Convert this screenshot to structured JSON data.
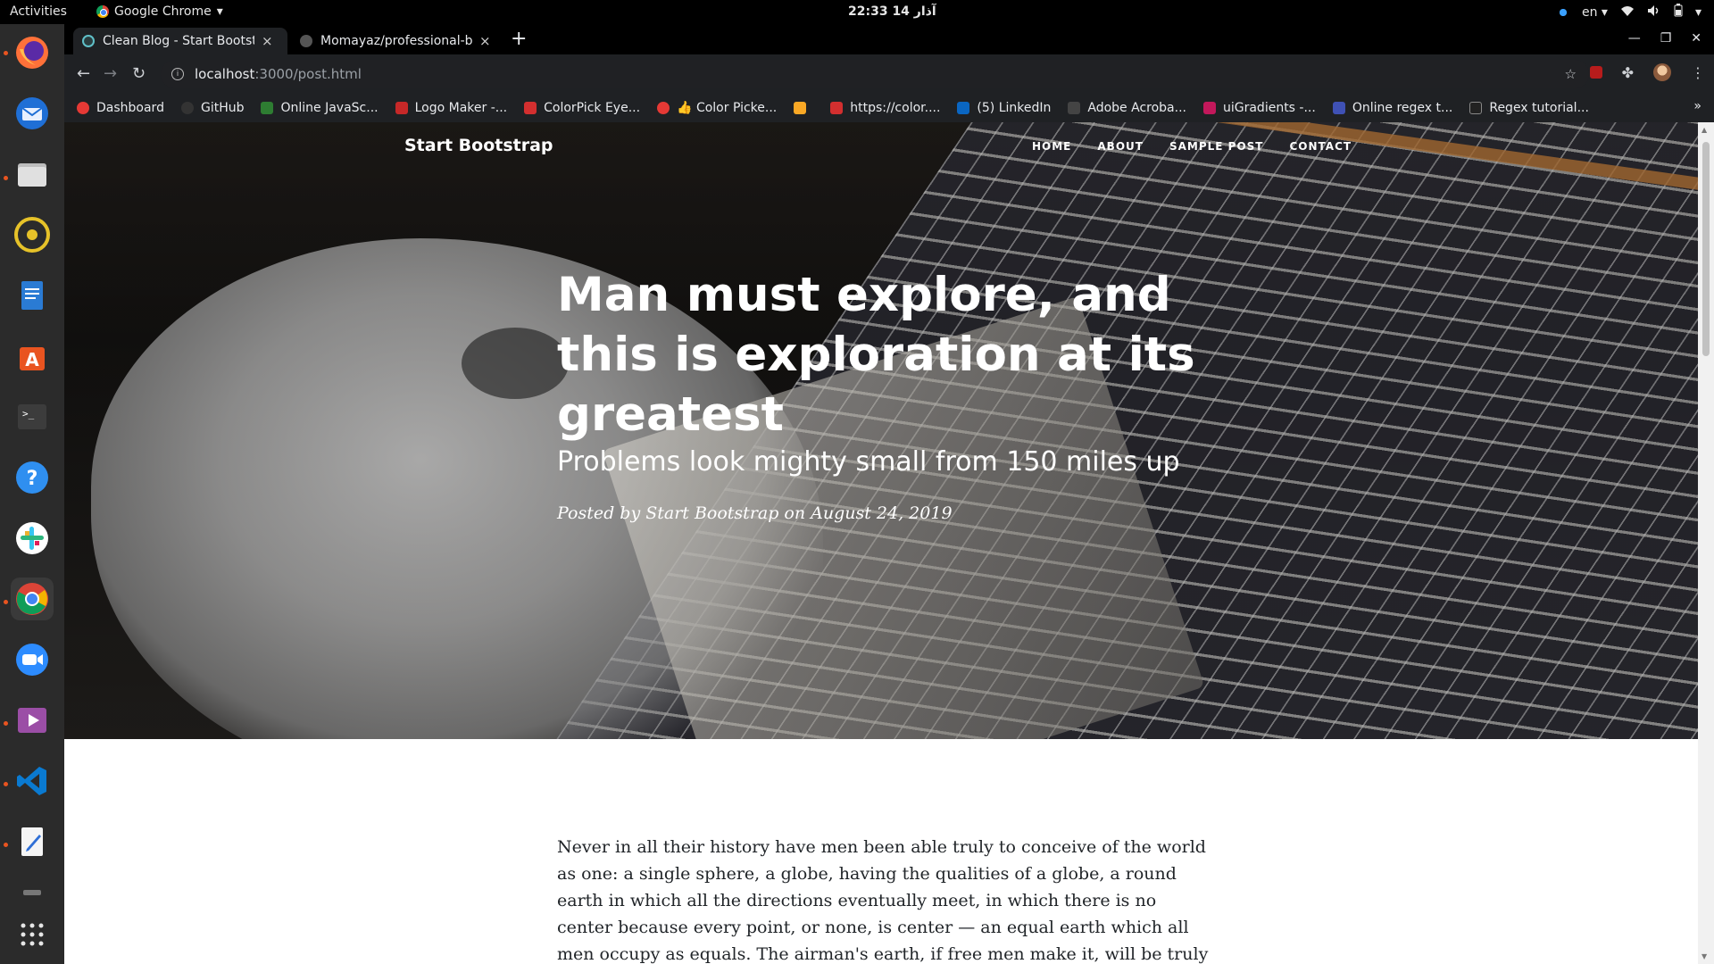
{
  "system": {
    "activities": "Activities",
    "app_name": "Google Chrome",
    "clock": "22:33  14 آذار",
    "lang": "en"
  },
  "dock": {
    "items": [
      "firefox",
      "thunderbird",
      "files",
      "rhythmbox",
      "libreoffice-writer",
      "ubuntu-software",
      "terminal",
      "help",
      "slack",
      "chrome",
      "zoom",
      "media-player",
      "vscode",
      "text-editor",
      "trash",
      "show-applications"
    ]
  },
  "browser": {
    "tabs": [
      {
        "title": "Clean Blog - Start Bootstrap",
        "close": "×"
      },
      {
        "title": "Momayaz/professional-blog",
        "close": "×"
      }
    ],
    "newtab": "+",
    "url_host": "localhost",
    "url_path": ":3000/post.html",
    "bookmarks": [
      {
        "label": "Dashboard",
        "color": "#e53935"
      },
      {
        "label": "GitHub",
        "color": "#333333"
      },
      {
        "label": "Online JavaSc...",
        "color": "#2e7d32"
      },
      {
        "label": "Logo Maker -...",
        "color": "#c62828"
      },
      {
        "label": "ColorPick Eye...",
        "color": "#d32f2f"
      },
      {
        "label": "👍 Color Picke...",
        "color": "#e53935"
      },
      {
        "label": "",
        "color": "#f9a825"
      },
      {
        "label": "https://color....",
        "color": "#d32f2f"
      },
      {
        "label": "(5) LinkedIn",
        "color": "#0a66c2"
      },
      {
        "label": "Adobe Acroba...",
        "color": "#444444"
      },
      {
        "label": "uiGradients -...",
        "color": "#c2185b"
      },
      {
        "label": "Online regex t...",
        "color": "#3f51b5"
      },
      {
        "label": "Regex tutorial...",
        "color": "#222222"
      }
    ],
    "bookmarks_more": "»"
  },
  "page": {
    "brand": "Start Bootstrap",
    "nav": [
      "HOME",
      "ABOUT",
      "SAMPLE POST",
      "CONTACT"
    ],
    "title": "Man must explore, and this is exploration at its greatest",
    "subtitle": "Problems look mighty small from 150 miles up",
    "meta": "Posted by Start Bootstrap on August 24, 2019",
    "body": "Never in all their history have men been able truly to conceive of the world as one: a single sphere, a globe, having the qualities of a globe, a round earth in which all the directions eventually meet, in which there is no center because every point, or none, is center — an equal earth which all men occupy as equals. The airman's earth, if free men make it, will be truly round: a globe in practice, not in theory."
  }
}
